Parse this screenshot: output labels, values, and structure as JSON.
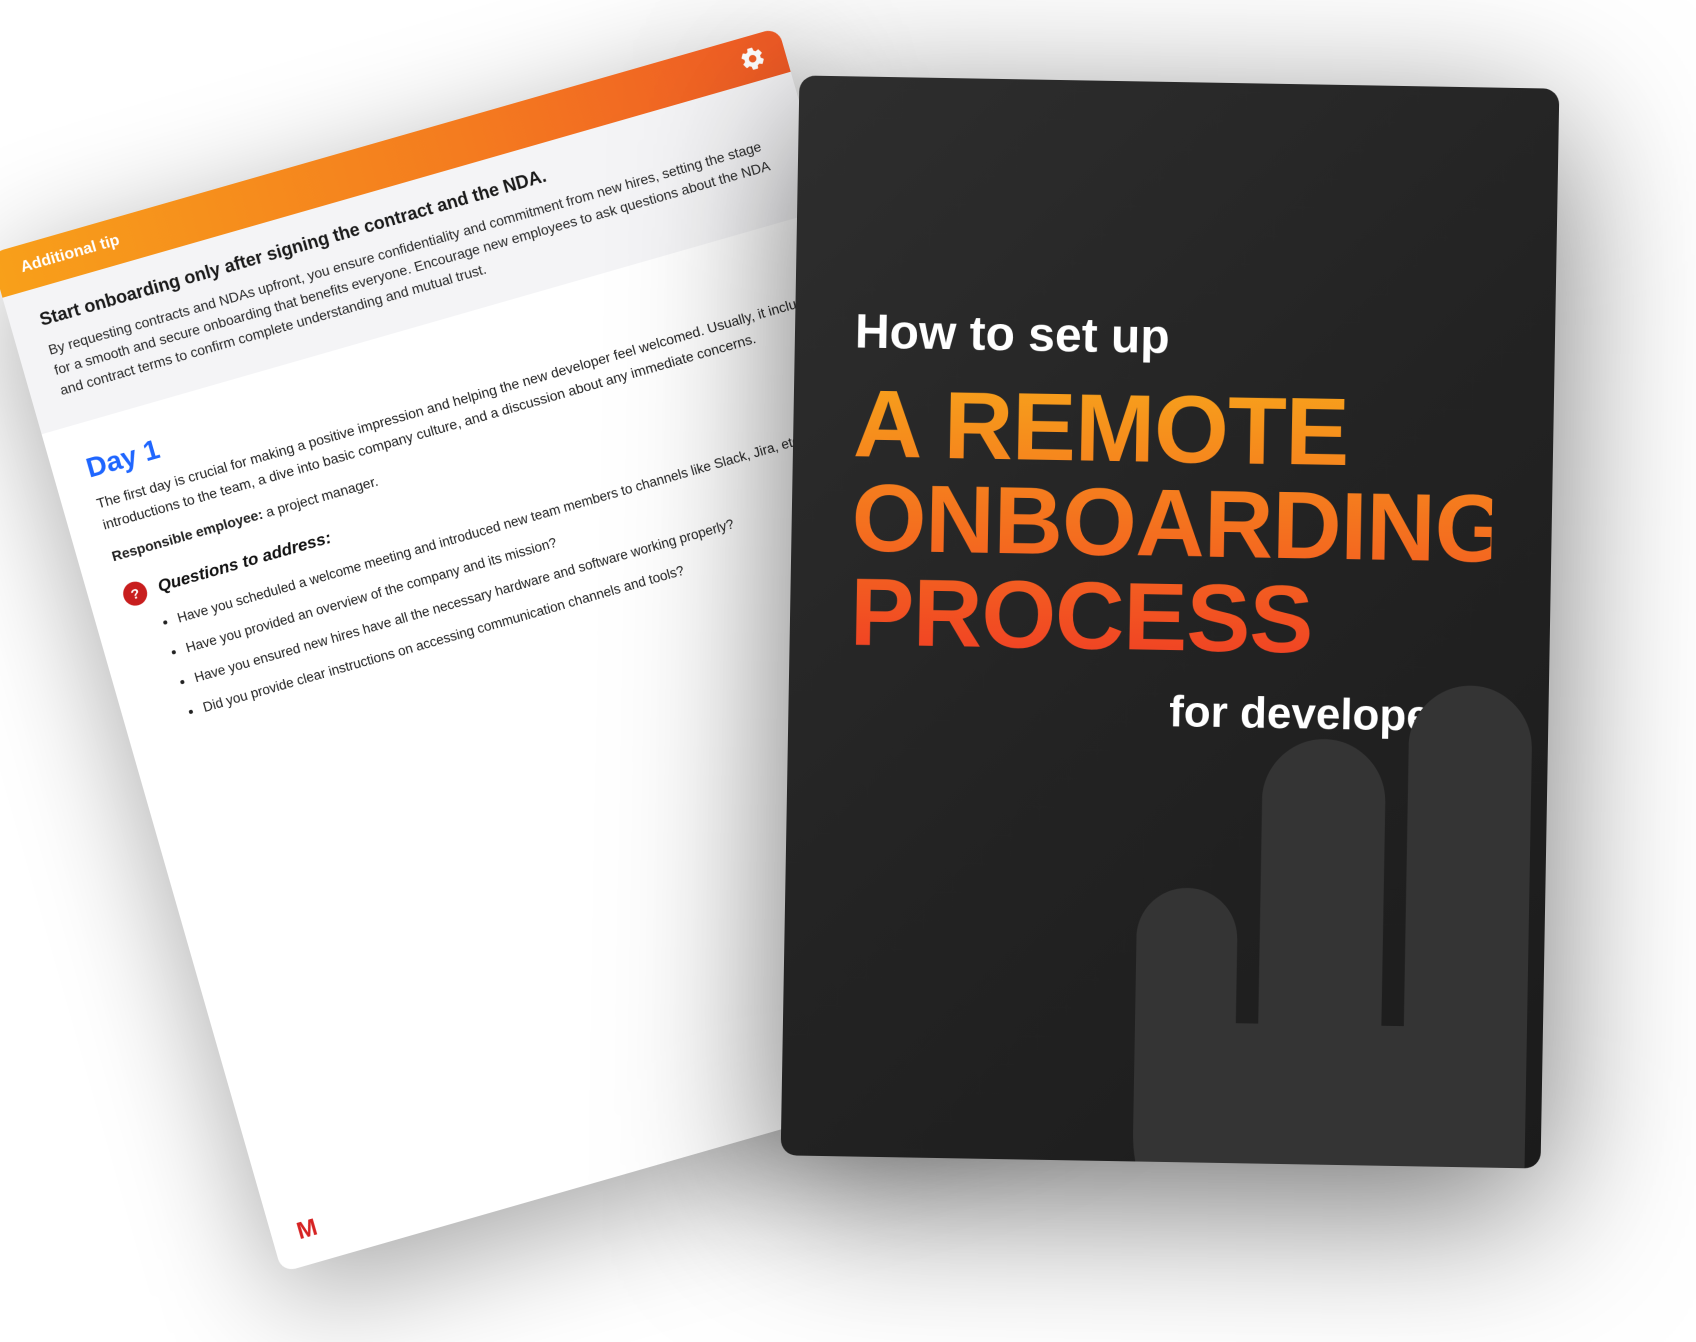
{
  "back_page": {
    "tip_label": "Additional tip",
    "tip_heading": "Start onboarding only after signing the contract and the NDA.",
    "tip_body": "By requesting contracts and NDAs upfront, you ensure confidentiality and commitment from new hires, setting the stage for a smooth and secure onboarding that benefits everyone. Encourage new employees to ask questions about the NDA and contract terms to confirm complete understanding and mutual trust.",
    "day_heading": "Day 1",
    "day_intro": "The first day is crucial for making a positive impression and helping the new developer feel welcomed. Usually, it includes introductions to the team, a dive into basic company culture, and a discussion about any immediate concerns.",
    "responsible_label": "Responsible employee:",
    "responsible_value": "a project manager.",
    "questions_heading": "Questions to address:",
    "questions": [
      "Have you scheduled a welcome meeting and introduced new team members to channels like Slack, Jira, etc.?",
      "Have you provided an overview of the company and its mission?",
      "Have you ensured new hires have all the necessary hardware and software working properly?",
      "Did you provide clear instructions on accessing communication channels and tools?"
    ],
    "logo_letter": "M"
  },
  "cover": {
    "line1": "How to set up",
    "big_words": [
      "A REMOTE",
      "ONBOARDING",
      "PROCESS"
    ],
    "line2": "for developers"
  }
}
